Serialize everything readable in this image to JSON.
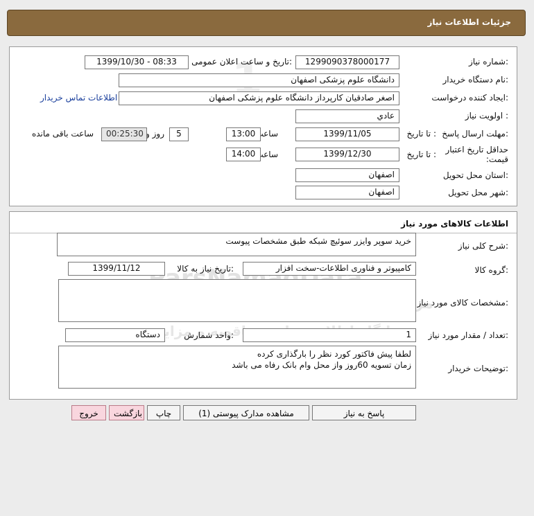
{
  "header": {
    "title": "جزئیات اطلاعات نیاز"
  },
  "details": {
    "need_number_label": "شماره نیاز:",
    "need_number": "1299090378000177",
    "announce_label": "تاریخ و ساعت اعلان عمومی:",
    "announce_value": "1399/10/30 - 08:33",
    "buyer_org_label": "نام دستگاه خریدار:",
    "buyer_org": "دانشگاه علوم پزشکی اصفهان",
    "requester_label": "ایجاد کننده درخواست:",
    "requester": "اصغر صادقیان کارپرداز دانشگاه علوم پزشکی اصفهان",
    "contact_link": "اطلاعات تماس خریدار",
    "priority_label": "اولویت نیاز :",
    "priority": "عادي",
    "deadline_label": "مهلت ارسال پاسخ:",
    "to_date_label": "تا تاریخ :",
    "deadline_date": "1399/11/05",
    "time_label": "ساعت",
    "deadline_time": "13:00",
    "days_value": "5",
    "days_label": "روز و",
    "remaining_time": "00:25:30",
    "remaining_label": "ساعت باقی مانده",
    "price_validity_label": "حداقل تاریخ اعتبار قیمت:",
    "price_to_date_label": "تا تاریخ :",
    "price_validity_date": "1399/12/30",
    "price_time_label": "ساعت",
    "price_validity_time": "14:00",
    "province_label": "استان محل تحویل:",
    "province": "اصفهان",
    "city_label": "شهر محل تحویل:",
    "city": "اصفهان"
  },
  "goods": {
    "section_title": "اطلاعات کالاهای مورد نیاز",
    "description_label": "شرح کلی نیاز:",
    "description": "خرید سوپر وایزر سوئیچ شبکه  طبق مشخصات پیوست",
    "group_label": "گروه کالا:",
    "group": "کامپیوتر و فناوری اطلاعات-سخت افزار",
    "need_date_label": "تاریخ نیاز به کالا:",
    "need_date": "1399/11/12",
    "specs_label": "مشخصات کالای مورد نیاز:",
    "specs": "",
    "quantity_label": "تعداد / مقدار مورد نیاز:",
    "quantity": "1",
    "unit_label": "واحد شمارش:",
    "unit": "دستگاه",
    "buyer_notes_label": "توضیحات خریدار:",
    "buyer_notes_line1": "لطفا پیش فاکتور کورد نظر را بارگذاری کرده",
    "buyer_notes_line2": "زمان تسویه 60روز واز محل وام بانک رفاه می باشد"
  },
  "actions": {
    "reply": "پاسخ به نیاز",
    "attachments": "مشاهده مدارک پیوستی (1)",
    "print": "چاپ",
    "back": "بازگشت",
    "exit": "خروج"
  },
  "watermark": {
    "brand_en": "ParsNamadData",
    "brand_fa": "مرکز فرآوری اطلاعات پارس نماد داده ها",
    "brand_fa2": "پایگاه اطلاع رسانی مناقصه و مزایده",
    "phone": "۰۲۱-۸۸۳۴۹۶۷۰"
  },
  "colors": {
    "header_bg": "#8a6a3e",
    "link": "#1a3f9c",
    "exit_btn": "#f9d6de"
  }
}
